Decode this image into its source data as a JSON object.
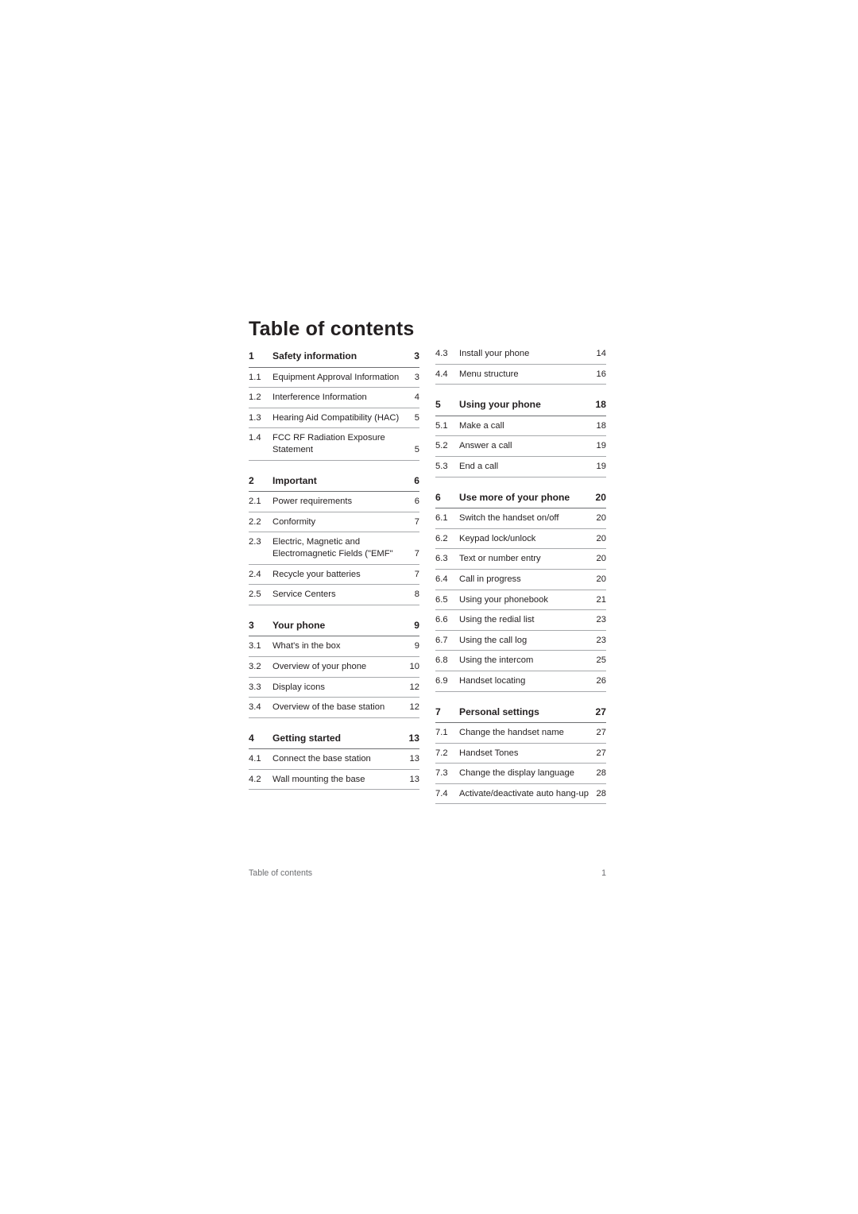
{
  "document": {
    "title": "Table of contents",
    "footer_left": "Table of contents",
    "footer_page": "1"
  },
  "toc": {
    "left_column": [
      {
        "num": "1",
        "label": "Safety information",
        "page": "3",
        "section": true
      },
      {
        "num": "1.1",
        "label": "Equipment Approval Information",
        "page": "3",
        "section": false
      },
      {
        "num": "1.2",
        "label": "Interference Information",
        "page": "4",
        "section": false
      },
      {
        "num": "1.3",
        "label": "Hearing Aid Compatibility (HAC)",
        "page": "5",
        "section": false
      },
      {
        "num": "1.4",
        "label": "FCC RF Radiation Exposure Statement",
        "page": "5",
        "section": false
      },
      {
        "num": "2",
        "label": "Important",
        "page": "6",
        "section": true
      },
      {
        "num": "2.1",
        "label": "Power requirements",
        "page": "6",
        "section": false
      },
      {
        "num": "2.2",
        "label": "Conformity",
        "page": "7",
        "section": false
      },
      {
        "num": "2.3",
        "label": "Electric, Magnetic and Electromagnetic Fields (\"EMF\"",
        "page": "7",
        "section": false
      },
      {
        "num": "2.4",
        "label": "Recycle your batteries",
        "page": "7",
        "section": false
      },
      {
        "num": "2.5",
        "label": "Service Centers",
        "page": "8",
        "section": false
      },
      {
        "num": "3",
        "label": "Your phone",
        "page": "9",
        "section": true
      },
      {
        "num": "3.1",
        "label": "What's in the box",
        "page": "9",
        "section": false
      },
      {
        "num": "3.2",
        "label": "Overview of your phone",
        "page": "10",
        "section": false
      },
      {
        "num": "3.3",
        "label": "Display icons",
        "page": "12",
        "section": false
      },
      {
        "num": "3.4",
        "label": "Overview of the base station",
        "page": "12",
        "section": false
      },
      {
        "num": "4",
        "label": "Getting started",
        "page": "13",
        "section": true
      },
      {
        "num": "4.1",
        "label": "Connect the base station",
        "page": "13",
        "section": false
      },
      {
        "num": "4.2",
        "label": "Wall mounting the base",
        "page": "13",
        "section": false
      }
    ],
    "right_column": [
      {
        "num": "4.3",
        "label": "Install your phone",
        "page": "14",
        "section": false
      },
      {
        "num": "4.4",
        "label": "Menu structure",
        "page": "16",
        "section": false
      },
      {
        "num": "5",
        "label": "Using your phone",
        "page": "18",
        "section": true
      },
      {
        "num": "5.1",
        "label": "Make a call",
        "page": "18",
        "section": false
      },
      {
        "num": "5.2",
        "label": "Answer a call",
        "page": "19",
        "section": false
      },
      {
        "num": "5.3",
        "label": "End a call",
        "page": "19",
        "section": false
      },
      {
        "num": "6",
        "label": "Use more of your phone",
        "page": "20",
        "section": true
      },
      {
        "num": "6.1",
        "label": "Switch the handset on/off",
        "page": "20",
        "section": false
      },
      {
        "num": "6.2",
        "label": "Keypad lock/unlock",
        "page": "20",
        "section": false
      },
      {
        "num": "6.3",
        "label": "Text or number entry",
        "page": "20",
        "section": false
      },
      {
        "num": "6.4",
        "label": "Call in progress",
        "page": "20",
        "section": false
      },
      {
        "num": "6.5",
        "label": "Using your phonebook",
        "page": "21",
        "section": false
      },
      {
        "num": "6.6",
        "label": "Using the redial list",
        "page": "23",
        "section": false
      },
      {
        "num": "6.7",
        "label": "Using the call log",
        "page": "23",
        "section": false
      },
      {
        "num": "6.8",
        "label": "Using the intercom",
        "page": "25",
        "section": false
      },
      {
        "num": "6.9",
        "label": "Handset locating",
        "page": "26",
        "section": false
      },
      {
        "num": "7",
        "label": "Personal settings",
        "page": "27",
        "section": true
      },
      {
        "num": "7.1",
        "label": "Change the handset name",
        "page": "27",
        "section": false
      },
      {
        "num": "7.2",
        "label": "Handset Tones",
        "page": "27",
        "section": false
      },
      {
        "num": "7.3",
        "label": "Change the display language",
        "page": "28",
        "section": false
      },
      {
        "num": "7.4",
        "label": "Activate/deactivate auto hang-up",
        "page": "28",
        "section": false
      }
    ]
  }
}
